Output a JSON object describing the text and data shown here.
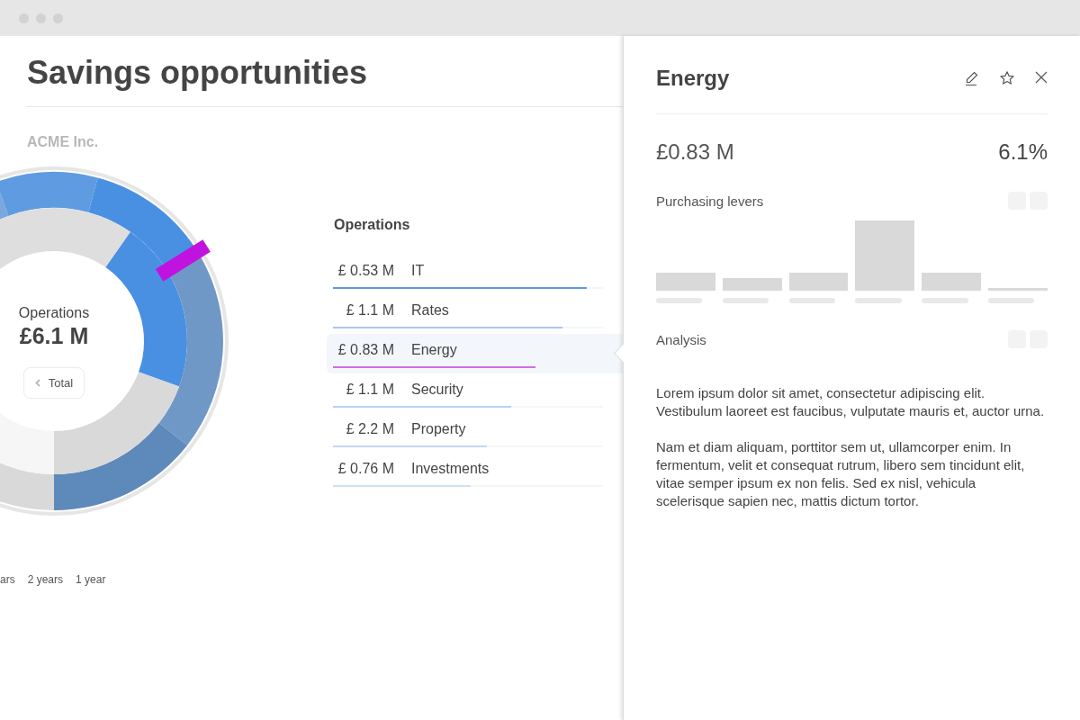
{
  "page": {
    "title": "Savings opportunities",
    "company": "ACME Inc."
  },
  "donut": {
    "label": "Operations",
    "total": "£6.1 M",
    "back_button": "Total"
  },
  "periods": [
    "ars",
    "2 years",
    "1 year"
  ],
  "list": {
    "title": "Operations",
    "rows": [
      {
        "amount": "£ 0.53 M",
        "name": "IT",
        "selected": false,
        "level": 0.94,
        "color": "#5b9be8"
      },
      {
        "amount": "£ 1.1 M",
        "name": "Rates",
        "selected": false,
        "level": 0.85,
        "color": "#a9c8ef"
      },
      {
        "amount": "£ 0.83 M",
        "name": "Energy",
        "selected": true,
        "level": 0.75,
        "color": "#d26ee8"
      },
      {
        "amount": "£ 1.1 M",
        "name": "Security",
        "selected": false,
        "level": 0.66,
        "color": "#b9d2f0"
      },
      {
        "amount": "£ 2.2 M",
        "name": "Property",
        "selected": false,
        "level": 0.57,
        "color": "#c2d8f2"
      },
      {
        "amount": "£ 0.76 M",
        "name": "Investments",
        "selected": false,
        "level": 0.51,
        "color": "#cfe0f4"
      }
    ]
  },
  "detail": {
    "title": "Energy",
    "amount": "£0.83 M",
    "share": "6.1%",
    "sections": [
      {
        "title": "Purchasing levers",
        "kind": "bars"
      },
      {
        "title": "Analysis",
        "kind": "text",
        "paragraphs": [
          "Lorem ipsum dolor sit amet, consectetur adipiscing elit. Vestibulum laoreet est faucibus, vulputate mauris et, auctor urna.",
          "Nam et diam aliquam, porttitor sem ut, ullamcorper enim. In fermentum, velit et consequat rutrum, libero sem tincidunt elit, vitae semper ipsum ex non felis. Sed ex nisl, vehicula scelerisque sapien nec, mattis dictum tortor."
        ]
      }
    ]
  }
}
